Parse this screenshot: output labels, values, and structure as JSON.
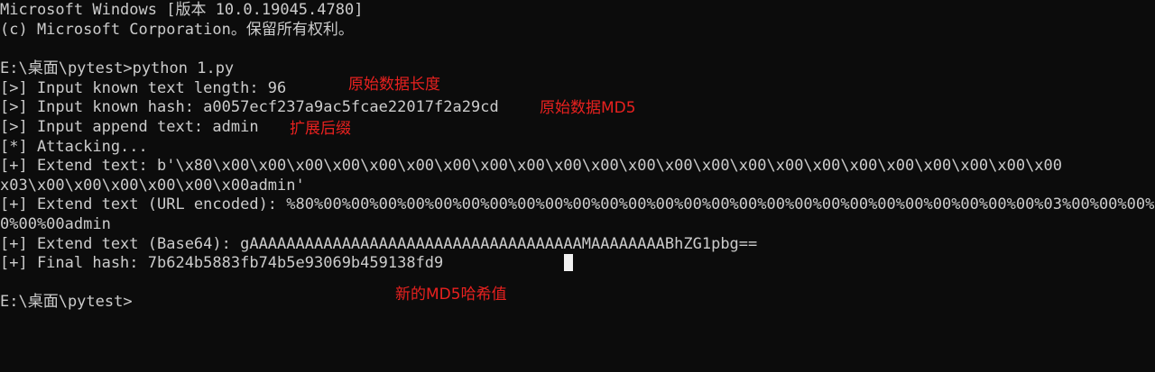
{
  "terminal": {
    "lines": [
      "Microsoft Windows [版本 10.0.19045.4780]",
      "(c) Microsoft Corporation。保留所有权利。",
      "",
      "E:\\桌面\\pytest>python 1.py",
      "[>] Input known text length: 96",
      "[>] Input known hash: a0057ecf237a9ac5fcae22017f2a29cd",
      "[>] Input append text: admin",
      "[*] Attacking...",
      "[+] Extend text: b'\\x80\\x00\\x00\\x00\\x00\\x00\\x00\\x00\\x00\\x00\\x00\\x00\\x00\\x00\\x00\\x00\\x00\\x00\\x00\\x00\\x00\\x00\\x00\\x00",
      "x03\\x00\\x00\\x00\\x00\\x00\\x00admin'",
      "[+] Extend text (URL encoded): %80%00%00%00%00%00%00%00%00%00%00%00%00%00%00%00%00%00%00%00%00%00%00%00%00%00%00%03%00%00%00%",
      "0%00%00admin",
      "[+] Extend text (Base64): gAAAAAAAAAAAAAAAAAAAAAAAAAAAAAAAAAAAAMAAAAAAAABhZG1pbg==",
      "[+] Final hash: 7b624b5883fb74b5e93069b459138fd9",
      "",
      "E:\\桌面\\pytest>"
    ]
  },
  "annotations": {
    "original_length": "原始数据长度",
    "original_md5": "原始数据MD5",
    "extend_suffix": "扩展后缀",
    "new_md5": "新的MD5哈希值"
  },
  "colors": {
    "background": "#0c0c0c",
    "text": "#cccccc",
    "annotation": "#e8211f",
    "cursor": "#f2f2f2"
  }
}
